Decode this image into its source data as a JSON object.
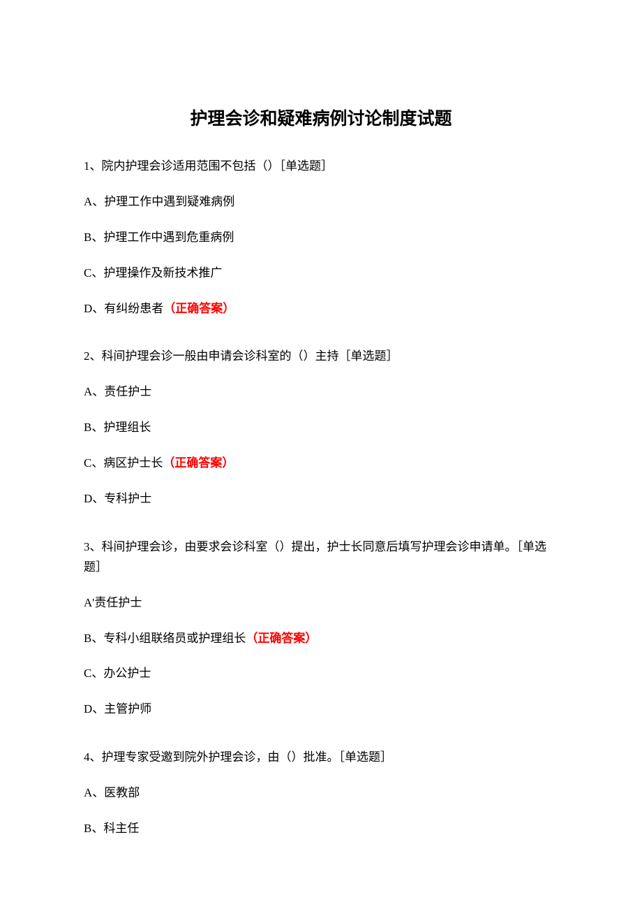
{
  "title": "护理会诊和疑难病例讨论制度试题",
  "correct_label": "（正确答案）",
  "q1": {
    "stem": "1、院内护理会诊适用范围不包括（）［单选题］",
    "a": "A、护理工作中遇到疑难病例",
    "b": "B、护理工作中遇到危重病例",
    "c": "C、护理操作及新技术推广",
    "d": "D、有纠纷患者"
  },
  "q2": {
    "stem": "2、科间护理会诊一般由申请会诊科室的（）主持［单选题］",
    "a": "A、责任护士",
    "b": "B、护理组长",
    "c": "C、病区护士长",
    "d": "D、专科护士"
  },
  "q3": {
    "stem": "3、科间护理会诊，由要求会诊科室（）提出，护士长同意后填写护理会诊申请单。［单选题］",
    "a": "A'责任护士",
    "b": "B、专科小组联络员或护理组长",
    "c": "C、办公护士",
    "d": "D、主管护师"
  },
  "q4": {
    "stem": "4、护理专家受邀到院外护理会诊，由（）批准。［单选题］",
    "a": "A、医教部",
    "b": "B、科主任"
  }
}
